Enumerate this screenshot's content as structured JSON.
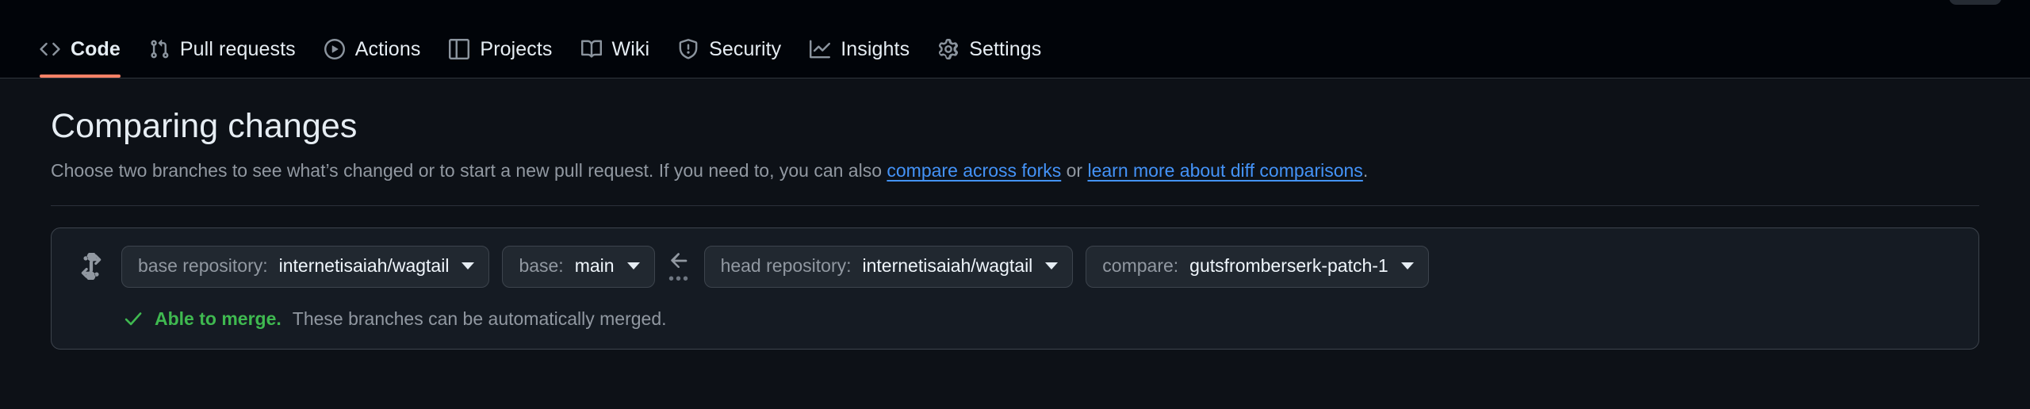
{
  "repo_nav": {
    "items": [
      {
        "label": "Code",
        "icon": "code-icon",
        "active": true
      },
      {
        "label": "Pull requests",
        "icon": "git-pull-request-icon",
        "active": false
      },
      {
        "label": "Actions",
        "icon": "play-circle-icon",
        "active": false
      },
      {
        "label": "Projects",
        "icon": "table-icon",
        "active": false
      },
      {
        "label": "Wiki",
        "icon": "book-icon",
        "active": false
      },
      {
        "label": "Security",
        "icon": "shield-icon",
        "active": false
      },
      {
        "label": "Insights",
        "icon": "graph-icon",
        "active": false
      },
      {
        "label": "Settings",
        "icon": "gear-icon",
        "active": false
      }
    ],
    "active_underline_color": "#f78166"
  },
  "page": {
    "title": "Comparing changes",
    "subtitle_part1": "Choose two branches to see what’s changed or to start a new pull request. If you need to, you can also ",
    "link_compare_forks": "compare across forks",
    "subtitle_or": " or ",
    "link_learn_more": "learn more about diff comparisons",
    "subtitle_end": ".",
    "link_color": "#4493f8"
  },
  "compare_card": {
    "compare_icon": "git-compare-icon",
    "base_repository": {
      "prefix": "base repository:",
      "value": "internetisaiah/wagtail"
    },
    "base_branch": {
      "prefix": "base:",
      "value": "main"
    },
    "separator": {
      "arrow": "arrow-left-icon",
      "dots": "•••"
    },
    "head_repository": {
      "prefix": "head repository:",
      "value": "internetisaiah/wagtail"
    },
    "compare_branch": {
      "prefix": "compare:",
      "value": "gutsfromberserk-patch-1"
    },
    "merge_status": {
      "icon": "check-icon",
      "strong": "Able to merge.",
      "text": "These branches can be automatically merged.",
      "color": "#3fb950"
    }
  }
}
